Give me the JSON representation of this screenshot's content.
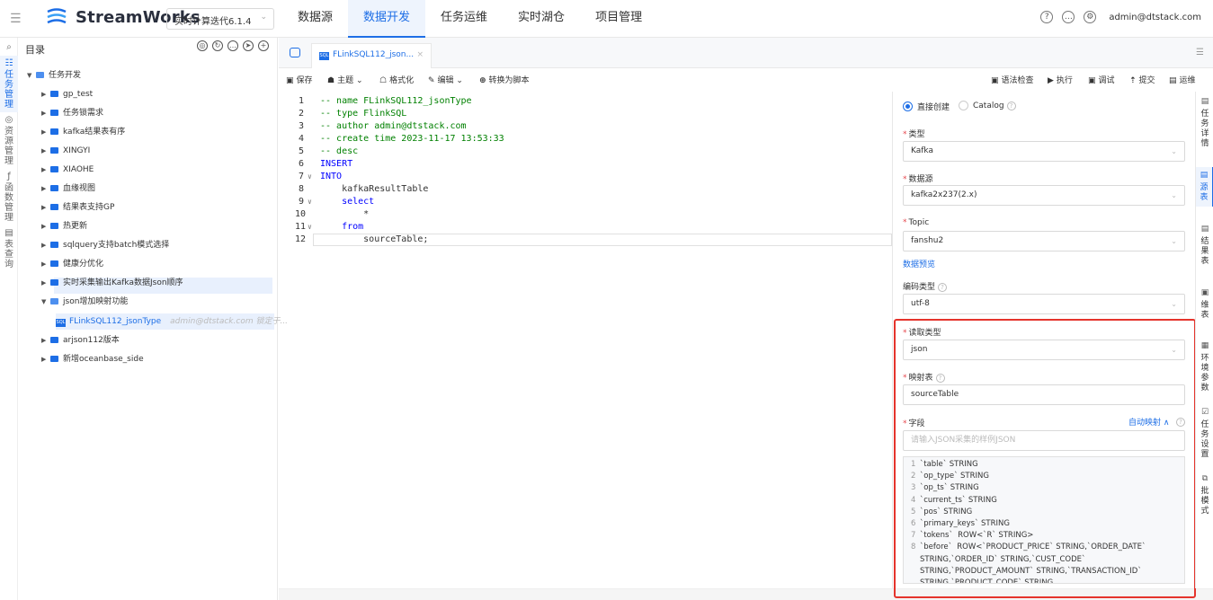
{
  "app": {
    "brand": "StreamWorks",
    "version": "实时计算迭代6.1.4",
    "user": "admin@dtstack.com"
  },
  "nav": [
    "数据源",
    "数据开发",
    "任务运维",
    "实时湖仓",
    "项目管理"
  ],
  "left_rail": [
    {
      "label": "任务管理",
      "icon": "☷"
    },
    {
      "label": "资源管理",
      "icon": "◎"
    },
    {
      "label": "函数管理",
      "icon": "ƒ"
    },
    {
      "label": "表查询",
      "icon": "▤"
    }
  ],
  "tree": {
    "title": "目录",
    "root": "任务开发",
    "items": [
      "gp_test",
      "任务锁需求",
      "kafka结果表有序",
      "XINGYI",
      "XIAOHE",
      "血缘视图",
      "结果表支持GP",
      "热更新",
      "sqlquery支持batch模式选择",
      "健康分优化",
      "实时采集输出Kafka数据Json顺序",
      "json增加映射功能"
    ],
    "selected_file": "FLinkSQL112_jsonType",
    "selected_meta": "admin@dtstack.com 锁定于...",
    "after": [
      "arjson112版本",
      "新增oceanbase_side"
    ]
  },
  "tab": {
    "label": "FLinkSQL112_json..."
  },
  "toolbar": {
    "save": "保存",
    "theme": "主题",
    "format": "格式化",
    "edit": "编辑",
    "convert": "转换为脚本",
    "syntax": "语法检查",
    "run": "执行",
    "debug": "调试",
    "submit": "提交",
    "ops": "运维"
  },
  "code": [
    "-- name FLinkSQL112_jsonType",
    "-- type FlinkSQL",
    "-- author admin@dtstack.com",
    "-- create time 2023-11-17 13:53:33",
    "-- desc",
    "INSERT",
    "INTO",
    "    kafkaResultTable",
    "    select",
    "        *",
    "    from",
    "        sourceTable;"
  ],
  "panel": {
    "radio1": "直接创建",
    "radio2": "Catalog",
    "type_label": "类型",
    "type_value": "Kafka",
    "source_label": "数据源",
    "source_value": "kafka2x237(2.x)",
    "topic_label": "Topic",
    "topic_value": "fanshu2",
    "preview": "数据预览",
    "encoding_label": "编码类型",
    "encoding_value": "utf-8",
    "read_label": "读取类型",
    "read_value": "json",
    "map_label": "映射表",
    "map_value": "sourceTable",
    "field_label": "字段",
    "auto_map": "自动映射",
    "json_placeholder": "请输入JSON采集的样例JSON",
    "fields": [
      "`table` STRING",
      "`op_type` STRING",
      "`op_ts` STRING",
      "`current_ts` STRING",
      "`pos` STRING",
      "`primary_keys` STRING",
      "`tokens`  ROW<`R` STRING>",
      "`before`  ROW<`PRODUCT_PRICE` STRING,`ORDER_DATE` STRING,`ORDER_ID` STRING,`CUST_CODE` STRING,`PRODUCT_AMOUNT` STRING,`TRANSACTION_ID` STRING,`PRODUCT_CODE` STRING"
    ]
  },
  "right_rail": [
    "任务详情",
    "源表",
    "结果表",
    "维表",
    "环境参数",
    "任务设置",
    "批模式"
  ]
}
